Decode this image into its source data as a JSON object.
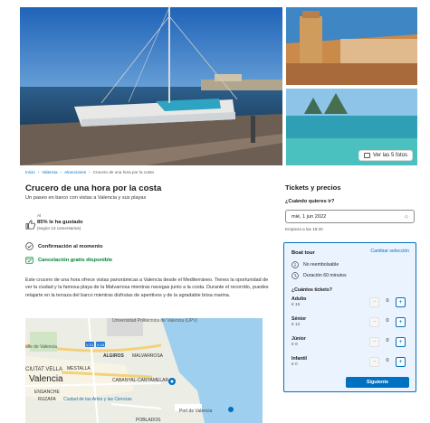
{
  "gallery": {
    "see_photos_label": "Ver las 5 fotos"
  },
  "breadcrumb": {
    "items": [
      "Inicio",
      "Valencia",
      "Atracciones"
    ],
    "current": "Crucero de una hora por la costa",
    "separator": "›"
  },
  "product": {
    "title": "Crucero de una hora por la costa",
    "subtitle": "Un paseo en barco con vistas a Valencia y sus playas",
    "rating_prefix": "Al",
    "rating_main": "85% le ha gustado",
    "rating_sub": "(según 13 comentarios)",
    "features": [
      "Confirmación al momento",
      "Cancelación gratis disponible"
    ],
    "description": "Este crucero de una hora ofrece vistas panorámicas a Valencia desde el Mediterráneo. Tienes la oportunidad de ver la ciudad y la famosa playa de la Malvarrosa mientras navegas junto a la costa. Durante el recorrido, puedes relajarte en la terraza del barco mientras disfrutas de aperitivos y de la agradable brisa marina."
  },
  "map": {
    "labels": {
      "university": "Universidad Politécnica de Valencia (UPV)",
      "valencia_left": "alle de Valencia",
      "algiros": "ALGIROS",
      "malvarrosa": "MALVARROSA",
      "ciutat_vella": "CIUTAT VELLA",
      "mestalla": "MESTALLA",
      "valencia": "Valencia",
      "cabanyal": "CABANYAL-CANYAMELAR",
      "ensanche": "ENSANCHE",
      "ruzafa": "RUZAFA",
      "arts": "Ciudad de las Artes y las Ciencias",
      "port": "Port de Valencia",
      "poblados": "POBLADOS",
      "road_numbers": [
        "V-21",
        "V-15"
      ]
    }
  },
  "booking": {
    "title": "Tickets y precios",
    "when_label": "¿Cuándo quieres ir?",
    "date_value": "mié, 1 jun 2022",
    "starts": "Empieza a las 18:30",
    "card_title": "Boat tour",
    "change_label": "Cambiar selección",
    "info": [
      "No reembolsable",
      "Duración 60 minutos"
    ],
    "how_many": "¿Cuántos tickets?",
    "tickets": [
      {
        "name": "Adulto",
        "price": "€ 15",
        "qty": "0"
      },
      {
        "name": "Sénior",
        "price": "€ 12",
        "qty": "0"
      },
      {
        "name": "Júnior",
        "price": "€ 9",
        "qty": "0"
      },
      {
        "name": "Infantil",
        "price": "€ 0",
        "qty": "0"
      }
    ],
    "minus_label": "−",
    "plus_label": "+",
    "next_label": "Siguiente"
  },
  "colors": {
    "accent": "#0071c2",
    "success": "#008234",
    "card_bg": "#ebf3ff"
  }
}
